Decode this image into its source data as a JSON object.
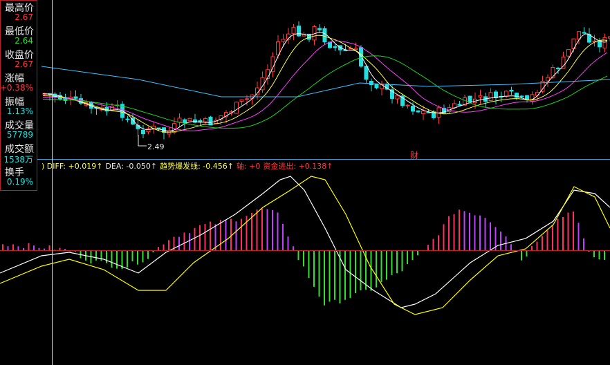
{
  "colors": {
    "up": "#ff3b3b",
    "down": "#22e0e0",
    "ma5": "#ffffff",
    "ma10": "#ffff40",
    "ma20": "#ff40ff",
    "ma60": "#20d020",
    "ma120": "#40c0ff",
    "diff": "#ffffff",
    "dea": "#ffff00",
    "macd_up": "#ff3060",
    "macd_down": "#30e030",
    "macd_up2": "#c040ff"
  },
  "side_panel": [
    {
      "label": "最高价",
      "value": "2.67",
      "color": "#ff3b3b"
    },
    {
      "label": "最低价",
      "value": "2.64",
      "color": "#30e030"
    },
    {
      "label": "收盘价",
      "value": "2.67",
      "color": "#ff3b3b"
    },
    {
      "label": "涨幅",
      "value": "+0.38%",
      "color": "#ff3b3b"
    },
    {
      "label": "振幅",
      "value": "1.13%",
      "color": "#22e0e0"
    },
    {
      "label": "成交量",
      "value": "57789",
      "color": "#22e0e0"
    },
    {
      "label": "成交额",
      "value": "1538万",
      "color": "#22e0e0"
    },
    {
      "label": "换手",
      "value": "0.19%",
      "color": "#22e0e0"
    }
  ],
  "indicator_bar": [
    {
      "text": ") DIFF: +0.019↑",
      "color": "#ffff40"
    },
    {
      "text": "DEA: -0.050↑",
      "color": "#e8e8e8"
    },
    {
      "text": "趋势爆发线: -0.456↑",
      "color": "#ffff40"
    },
    {
      "text": "轴: +0",
      "color": "#ff3b3b"
    },
    {
      "text": "资金进出: +0.138↑",
      "color": "#ff3b3b"
    }
  ],
  "min_label": "2.49",
  "cai_label": "财",
  "chart_data": {
    "type": "candlestick",
    "price_range": [
      2.43,
      3.36
    ],
    "candles_approx_count": 110,
    "visible_low": 2.49,
    "macd_range": [
      -1.0,
      1.0
    ]
  }
}
